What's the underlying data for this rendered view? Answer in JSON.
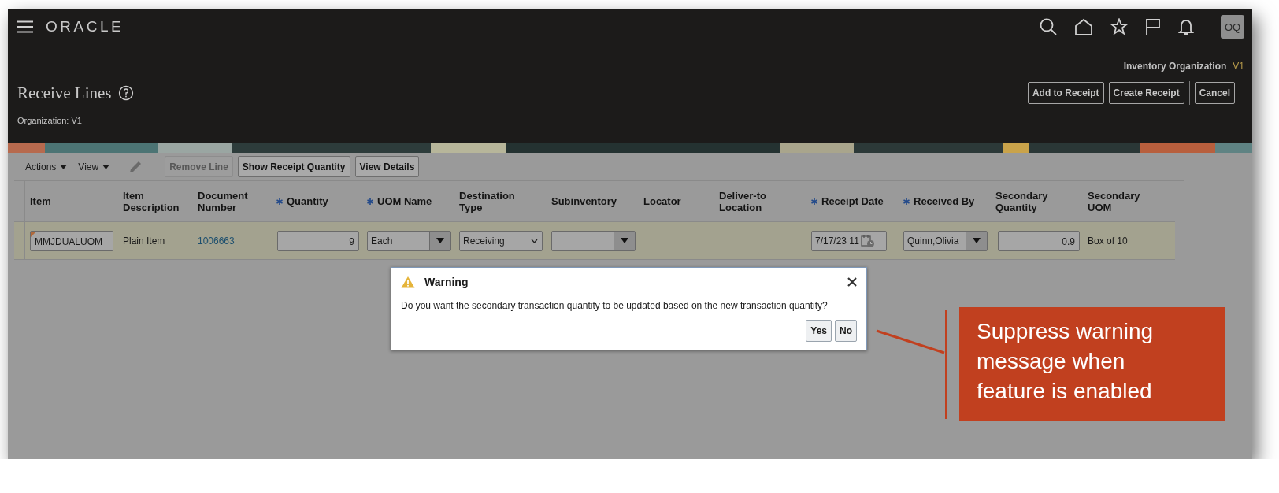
{
  "header": {
    "brand": "ORACLE",
    "avatar": "OQ",
    "context_label": "Inventory Organization",
    "context_value": "V1",
    "title": "Receive Lines",
    "subtitle": "Organization: V1",
    "buttons": [
      "Add to Receipt",
      "Create Receipt"
    ],
    "trailing_buttons": [
      "Cancel"
    ]
  },
  "toolbar": {
    "menus": [
      "Actions",
      "View"
    ],
    "buttons": [
      {
        "label": "Remove Line",
        "disabled": true
      },
      {
        "label": "Show Receipt Quantity",
        "disabled": false
      },
      {
        "label": "View Details",
        "disabled": false
      }
    ]
  },
  "table": {
    "columns": [
      {
        "label": "Item",
        "required": false
      },
      {
        "label": "Item Description",
        "required": false
      },
      {
        "label": "Document Number",
        "required": false
      },
      {
        "label": "Quantity",
        "required": true
      },
      {
        "label": "UOM Name",
        "required": true
      },
      {
        "label": "Destination Type",
        "required": false
      },
      {
        "label": "Subinventory",
        "required": false
      },
      {
        "label": "Locator",
        "required": false
      },
      {
        "label": "Deliver-to Location",
        "required": false
      },
      {
        "label": "Receipt Date",
        "required": true
      },
      {
        "label": "Received By",
        "required": true
      },
      {
        "label": "Secondary Quantity",
        "required": false
      },
      {
        "label": "Secondary UOM",
        "required": false
      }
    ],
    "rows": [
      {
        "cells": [
          {
            "kind": "input",
            "value": "MMJDUALUOM",
            "changed": true
          },
          {
            "kind": "text",
            "value": "Plain Item"
          },
          {
            "kind": "link",
            "value": "1006663"
          },
          {
            "kind": "number",
            "value": "9"
          },
          {
            "kind": "combo",
            "value": "Each"
          },
          {
            "kind": "select",
            "value": "Receiving"
          },
          {
            "kind": "combo"
          },
          {
            "kind": "empty"
          },
          {
            "kind": "empty"
          },
          {
            "kind": "date",
            "value": "7/17/23 11"
          },
          {
            "kind": "combo",
            "value": "Quinn,Olivia"
          },
          {
            "kind": "number",
            "value": "0.9"
          },
          {
            "kind": "text",
            "value": "Box of 10"
          }
        ]
      }
    ]
  },
  "dialog": {
    "title": "Warning",
    "message": "Do you want the secondary transaction quantity to be updated based on the new transaction quantity?",
    "buttons": [
      "Yes",
      "No"
    ]
  },
  "callout": {
    "text": "Suppress warning message when feature is enabled"
  }
}
